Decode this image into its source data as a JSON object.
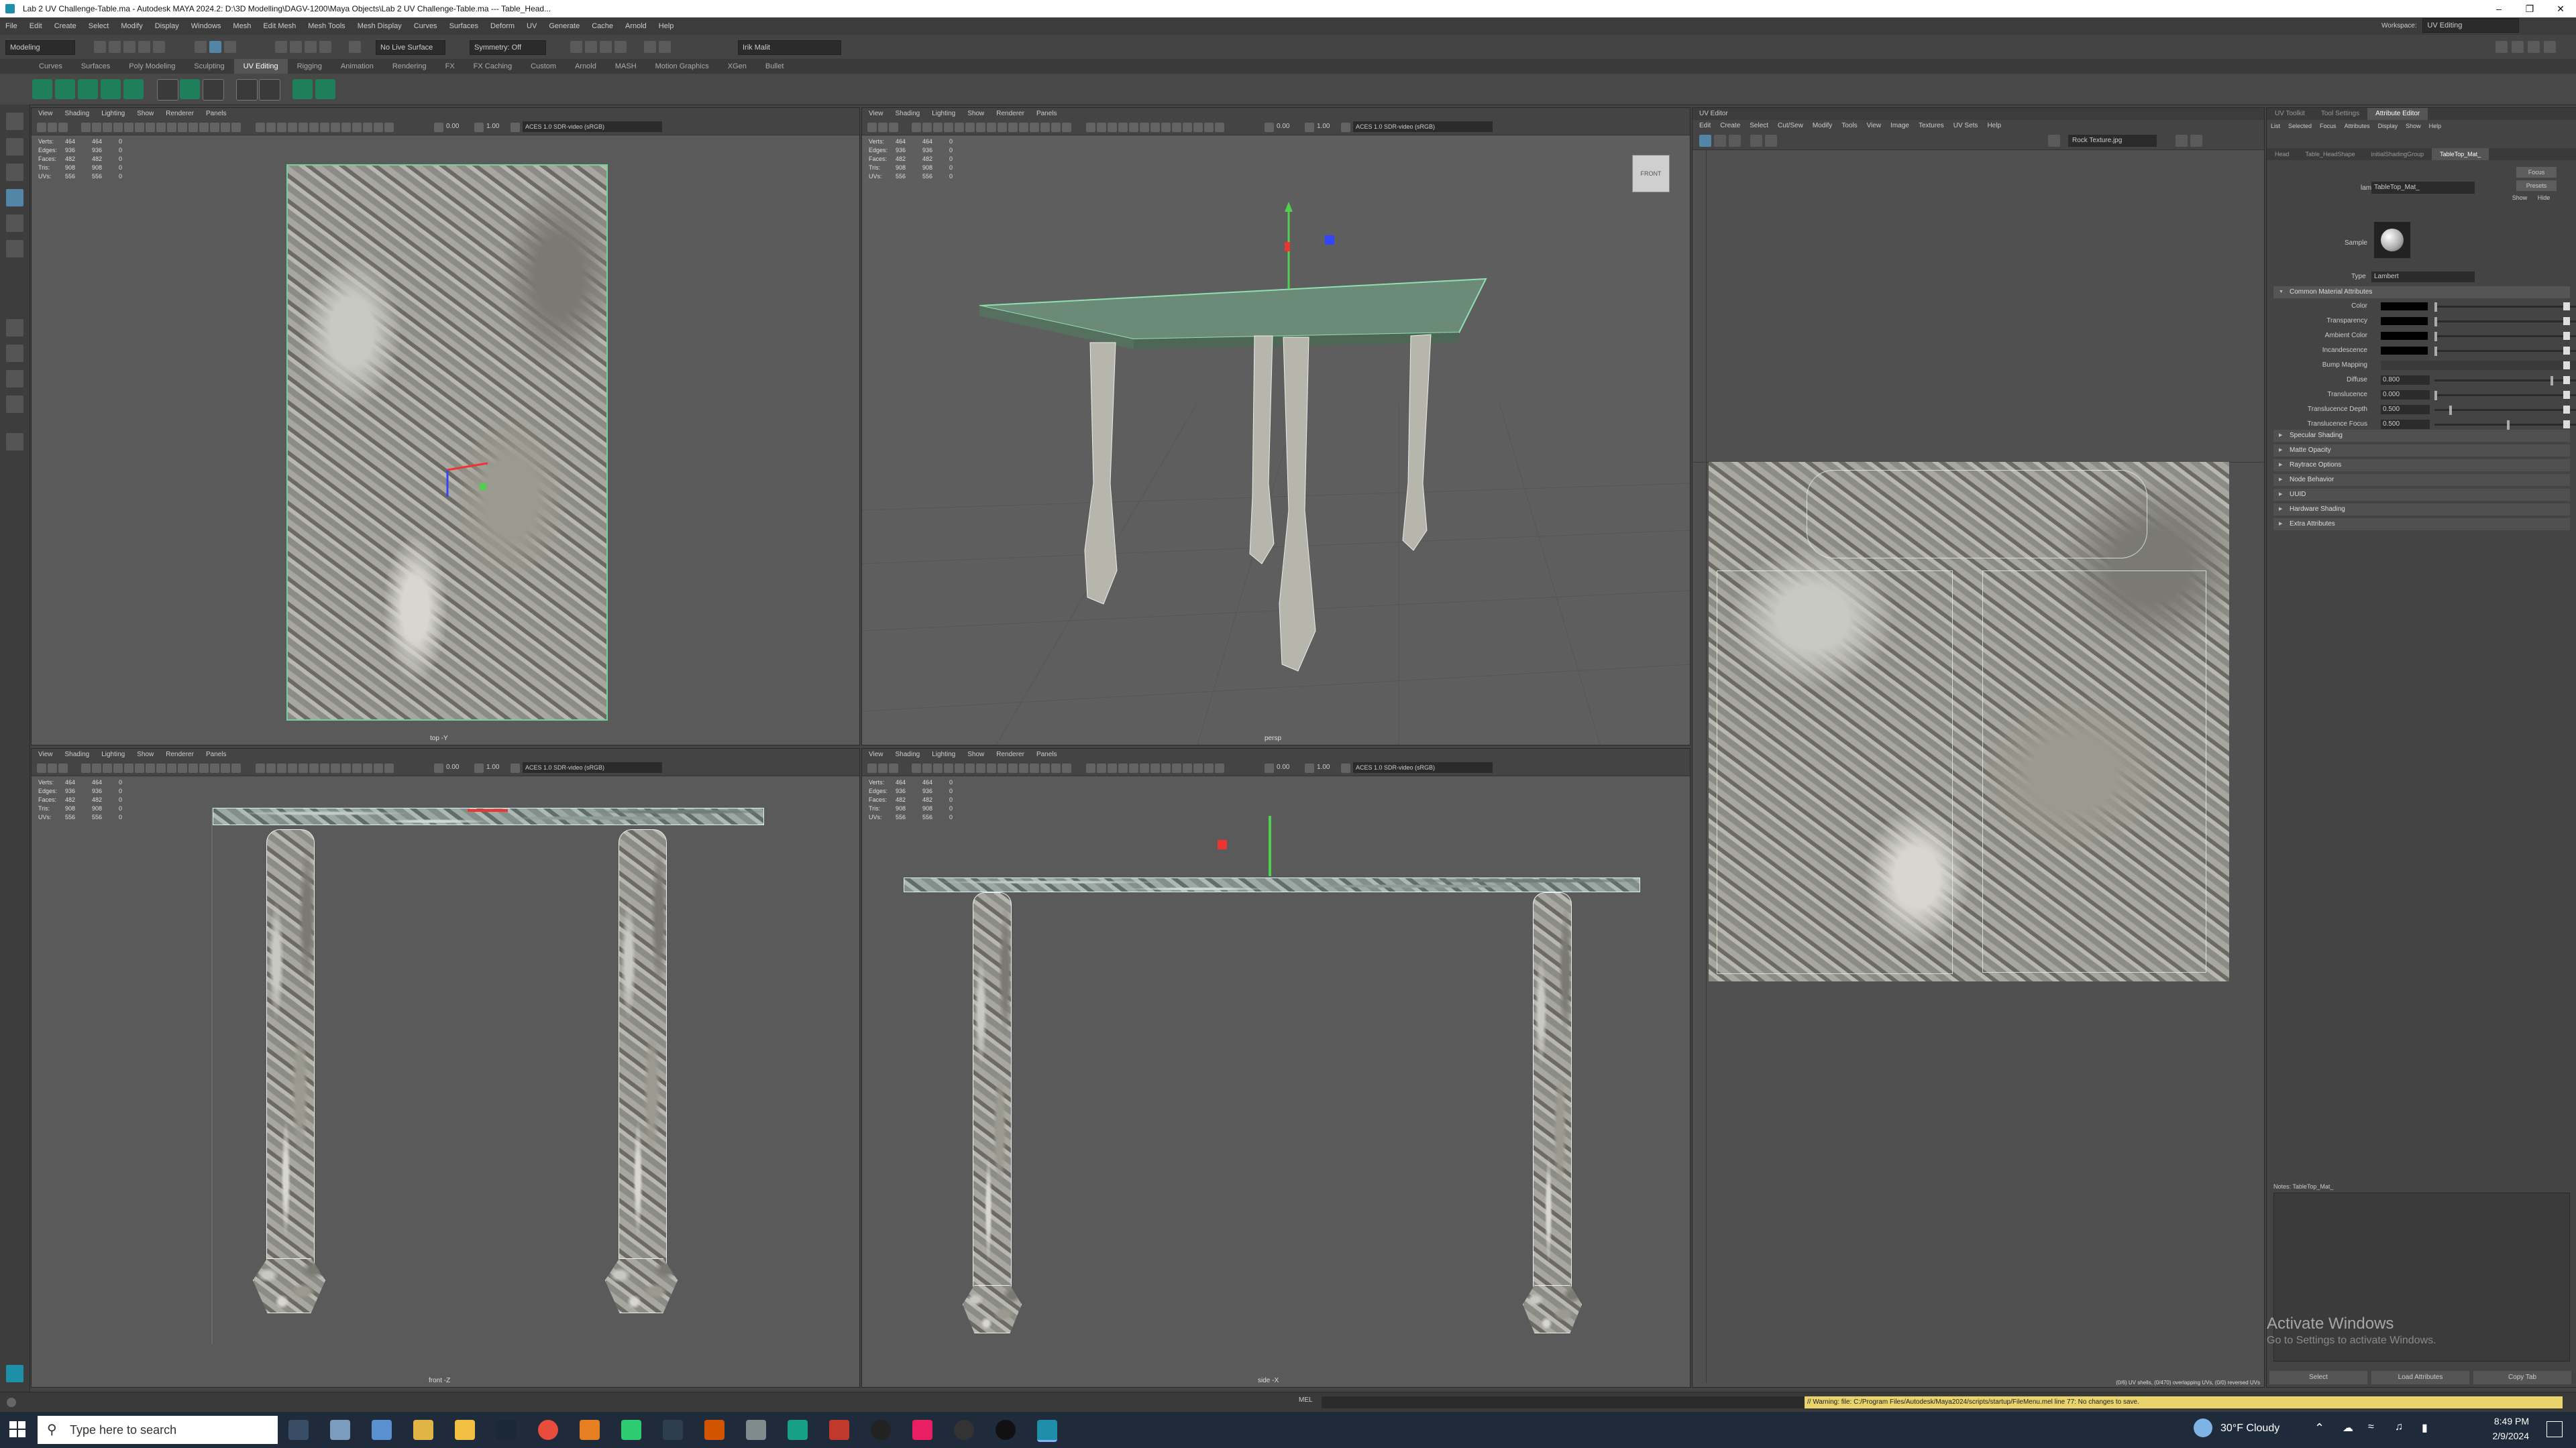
{
  "window": {
    "title": "Lab 2 UV Challenge-Table.ma - Autodesk MAYA 2024.2: D:\\3D Modelling\\DAGV-1200\\Maya Objects\\Lab 2 UV Challenge-Table.ma  ---  Table_Head..."
  },
  "menubar": {
    "items": [
      "File",
      "Edit",
      "Create",
      "Select",
      "Modify",
      "Display",
      "Windows",
      "Mesh",
      "Edit Mesh",
      "Mesh Tools",
      "Mesh Display",
      "Curves",
      "Surfaces",
      "Deform",
      "UV",
      "Generate",
      "Cache",
      "Arnold",
      "Help"
    ],
    "workspace_label": "Workspace:",
    "workspace_value": "UV Editing"
  },
  "statusline": {
    "mode": "Modeling",
    "live_surface": "No Live Surface",
    "symmetry": "Symmetry: Off",
    "user": "Irik Malit"
  },
  "shelf": {
    "tabs": [
      "Curves",
      "Surfaces",
      "Poly Modeling",
      "Sculpting",
      "UV Editing",
      "Rigging",
      "Animation",
      "Rendering",
      "FX",
      "FX Caching",
      "Custom",
      "Arnold",
      "MASH",
      "Motion Graphics",
      "XGen",
      "Bullet"
    ],
    "active": "UV Editing"
  },
  "viewport": {
    "menu": [
      "View",
      "Shading",
      "Lighting",
      "Show",
      "Renderer",
      "Panels"
    ],
    "val1": "0.00",
    "val2": "1.00",
    "colorspace": "ACES 1.0 SDR-video (sRGB)",
    "hud": {
      "labels": [
        "Verts:",
        "Edges:",
        "Faces:",
        "Tris:",
        "UVs:"
      ],
      "col1": [
        "464",
        "936",
        "482",
        "908",
        "556"
      ],
      "col2": [
        "464",
        "936",
        "482",
        "908",
        "556"
      ],
      "col3": [
        "0",
        "0",
        "0",
        "0",
        "0"
      ]
    },
    "cams": {
      "top": "top -Y",
      "persp": "persp",
      "front": "front -Z",
      "side": "side -X"
    },
    "viewcube_label": "FRONT"
  },
  "uv_editor": {
    "title": "UV Editor",
    "menu": [
      "Edit",
      "Create",
      "Select",
      "Cut/Sew",
      "Modify",
      "Tools",
      "View",
      "Image",
      "Textures",
      "UV Sets",
      "Help"
    ],
    "texture_name": "Rock Texture.jpg",
    "status": "(0/6) UV shells, (0/470) overlapping UVs, (0/0) reversed UVs"
  },
  "attr_editor": {
    "tabs_top": [
      "UV Toolkit",
      "Tool Settings",
      "Attribute Editor"
    ],
    "menu": [
      "List",
      "Selected",
      "Focus",
      "Attributes",
      "Display",
      "Show",
      "Help"
    ],
    "node_tabs": [
      "Head",
      "Table_HeadShape",
      "initialShadingGroup",
      "TableTop_Mat_"
    ],
    "lambert_label": "lambert:",
    "lambert_value": "TableTop_Mat_",
    "focus_btn": "Focus",
    "presets_btn": "Presets",
    "show_btn": "Show",
    "hide_btn": "Hide",
    "sample_label": "Sample",
    "type_label": "Type",
    "type_value": "Lambert",
    "common_section": "Common Material Attributes",
    "attrs": [
      {
        "label": "Color",
        "kind": "swatch"
      },
      {
        "label": "Transparency",
        "kind": "swatch"
      },
      {
        "label": "Ambient Color",
        "kind": "swatch"
      },
      {
        "label": "Incandescence",
        "kind": "swatch"
      },
      {
        "label": "Bump Mapping",
        "kind": "field"
      },
      {
        "label": "Diffuse",
        "kind": "num",
        "value": "0.800",
        "level": 0.8
      },
      {
        "label": "Translucence",
        "kind": "num",
        "value": "0.000",
        "level": 0.0
      },
      {
        "label": "Translucence Depth",
        "kind": "num",
        "value": "0.500",
        "level": 0.1
      },
      {
        "label": "Translucence Focus",
        "kind": "num",
        "value": "0.500",
        "level": 0.5
      }
    ],
    "sections": [
      "Specular Shading",
      "Matte Opacity",
      "Raytrace Options",
      "Node Behavior",
      "UUID",
      "Hardware Shading",
      "Extra Attributes"
    ],
    "notes": "Notes: TableTop_Mat_",
    "buttons": [
      "Select",
      "Load Attributes",
      "Copy Tab"
    ],
    "activate_title": "Activate Windows",
    "activate_sub": "Go to Settings to activate Windows."
  },
  "helpline": {
    "mel": "MEL",
    "warning": "// Warning: file: C:/Program Files/Autodesk/Maya2024/scripts/startup/FileMenu.mel line 77: No changes to save."
  },
  "taskbar": {
    "search_placeholder": "Type here to search",
    "weather": "30°F  Cloudy",
    "time": "8:49 PM",
    "date": "2/9/2024"
  },
  "colors": {
    "accent": "#5285a6",
    "selection_green": "#4fd08f",
    "helpline_warning": "#e8d36c"
  }
}
